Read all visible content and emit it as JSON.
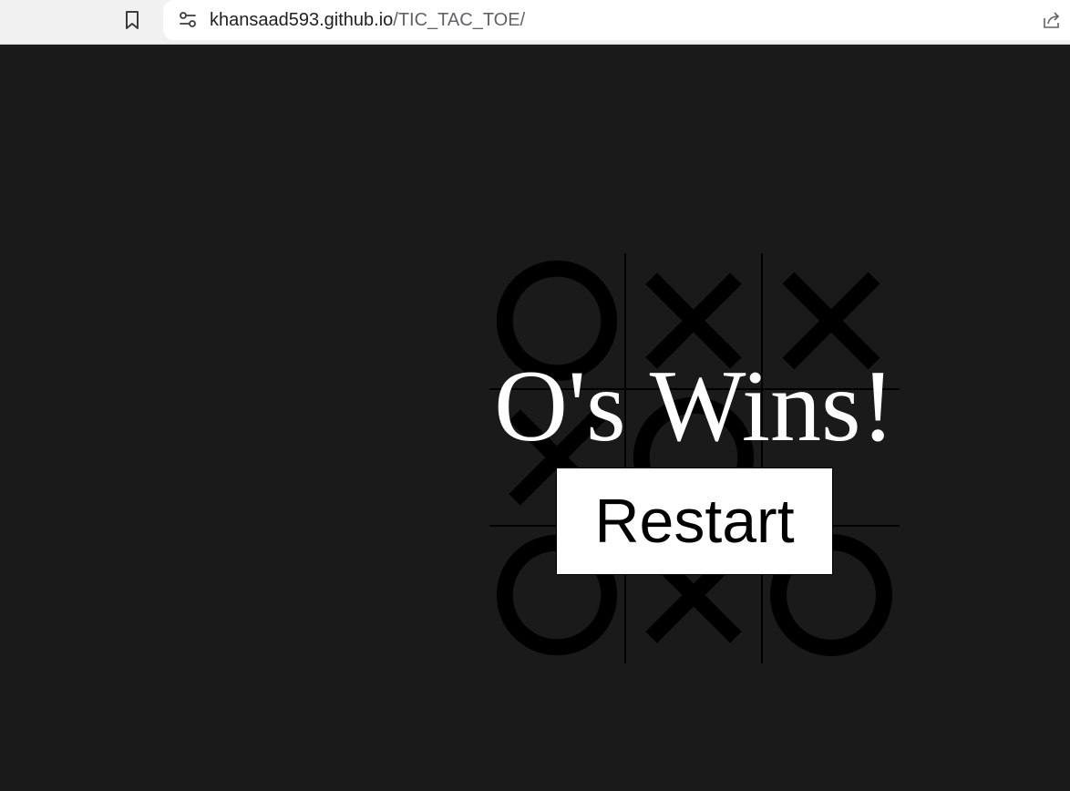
{
  "browser": {
    "url_host": "khansaad593.github.io",
    "url_path": "/TIC_TAC_TOE/"
  },
  "board": {
    "cells": [
      "O",
      "X",
      "X",
      "X",
      "O",
      "",
      "O",
      "X",
      "O"
    ],
    "mark_color": "#000000",
    "line_color": "#000000"
  },
  "game": {
    "win_message": "O's Wins!",
    "restart_label": "Restart"
  },
  "colors": {
    "background": "#1a1a1a",
    "message_text": "#ffffff",
    "button_background": "#ffffff"
  }
}
